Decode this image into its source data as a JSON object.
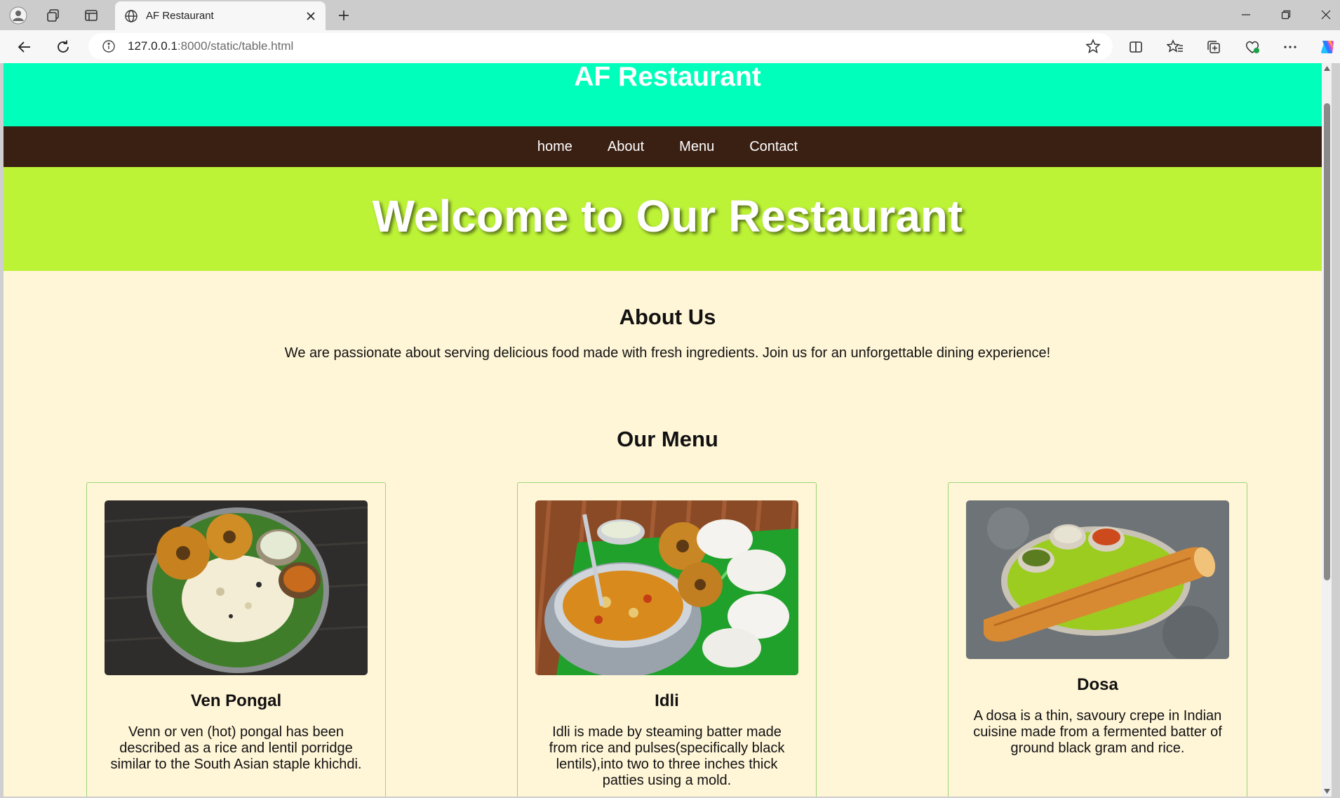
{
  "browser": {
    "tab_title": "AF Restaurant",
    "url_host": "127.0.0.1",
    "url_rest": ":8000/static/table.html"
  },
  "site": {
    "title": "AF Restaurant",
    "nav": [
      "home",
      "About",
      "Menu",
      "Contact"
    ],
    "hero": "Welcome to Our Restaurant",
    "about_heading": "About Us",
    "about_text": "We are passionate about serving delicious food made with fresh ingredients. Join us for an unforgettable dining experience!",
    "menu_heading": "Our Menu",
    "dishes": [
      {
        "name": "Ven Pongal",
        "description": "Venn or ven (hot) pongal has been described as a rice and lentil porridge similar to the South Asian staple khichdi."
      },
      {
        "name": "Idli",
        "description": "Idli is made by steaming batter made from rice and pulses(specifically black lentils),into two to three inches thick patties using a mold."
      },
      {
        "name": "Dosa",
        "description": "A dosa is a thin, savoury crepe in Indian cuisine made from a fermented batter of ground black gram and rice."
      }
    ]
  },
  "colors": {
    "header_bg": "#00ffbb",
    "nav_bg": "#3a2013",
    "hero_bg": "#bdf337",
    "page_bg": "#fff5d7",
    "card_border": "#9bd67a"
  }
}
